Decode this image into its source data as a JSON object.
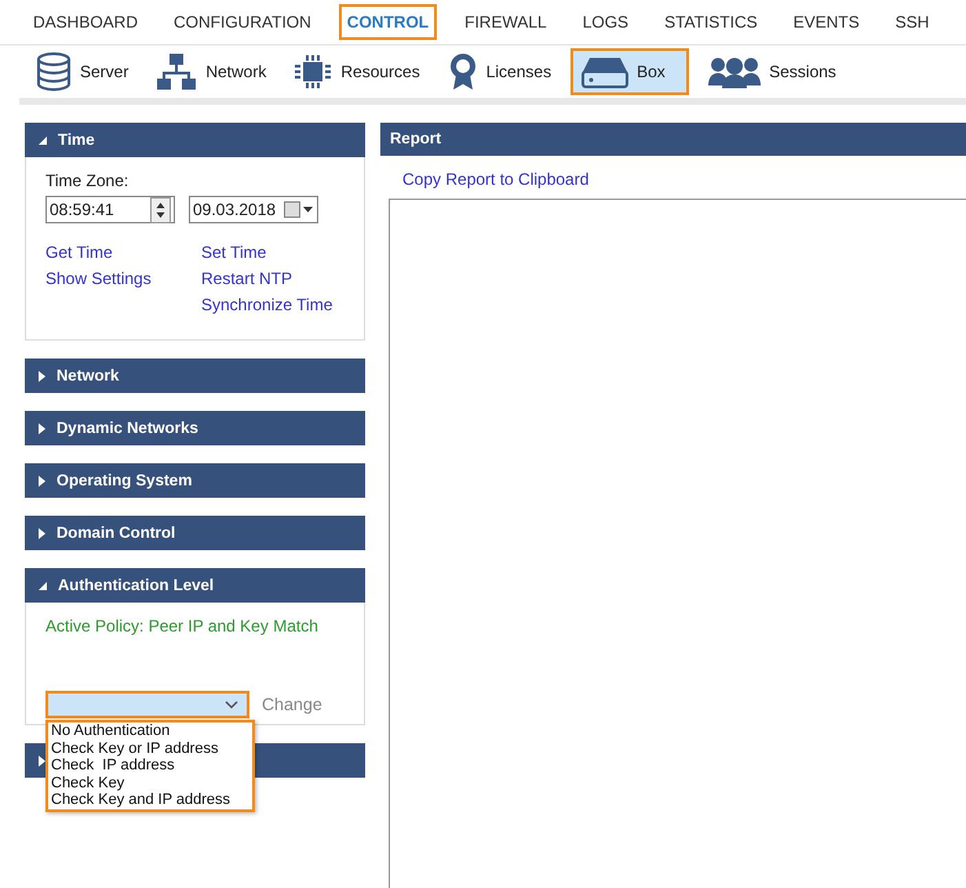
{
  "nav_tabs": [
    {
      "label": "DASHBOARD",
      "selected": false
    },
    {
      "label": "CONFIGURATION",
      "selected": false
    },
    {
      "label": "CONTROL",
      "selected": true
    },
    {
      "label": "FIREWALL",
      "selected": false
    },
    {
      "label": "LOGS",
      "selected": false
    },
    {
      "label": "STATISTICS",
      "selected": false
    },
    {
      "label": "EVENTS",
      "selected": false
    },
    {
      "label": "SSH",
      "selected": false
    }
  ],
  "toolbar": [
    {
      "kind": "server",
      "label": "Server",
      "selected": false
    },
    {
      "kind": "network",
      "label": "Network",
      "selected": false
    },
    {
      "kind": "resources",
      "label": "Resources",
      "selected": false
    },
    {
      "kind": "licenses",
      "label": "Licenses",
      "selected": false
    },
    {
      "kind": "box",
      "label": "Box",
      "selected": true
    },
    {
      "kind": "sessions",
      "label": "Sessions",
      "selected": false
    }
  ],
  "panels": [
    {
      "kind": "time",
      "title": "Time",
      "expanded": true,
      "label": "Time Zone:",
      "time": "08:59:41",
      "date": "09.03.2018",
      "links_left": [
        "Get Time",
        "Show Settings"
      ],
      "links_right": [
        "Set Time",
        "Restart NTP",
        "Synchronize Time"
      ]
    },
    {
      "title": "Network",
      "expanded": false
    },
    {
      "title": "Dynamic Networks",
      "expanded": false
    },
    {
      "title": "Operating System",
      "expanded": false
    },
    {
      "title": "Domain Control",
      "expanded": false
    },
    {
      "kind": "auth",
      "title": "Authentication Level",
      "expanded": true,
      "policy": "Active Policy: Peer IP and Key Match",
      "button": "Change",
      "options": [
        "No Authentication",
        "Check Key or IP address",
        "Check  IP address",
        "Check Key",
        "Check Key and IP address"
      ]
    },
    {
      "expanded": false
    }
  ],
  "report": {
    "title": "Report",
    "link": "Copy Report to Clipboard"
  }
}
